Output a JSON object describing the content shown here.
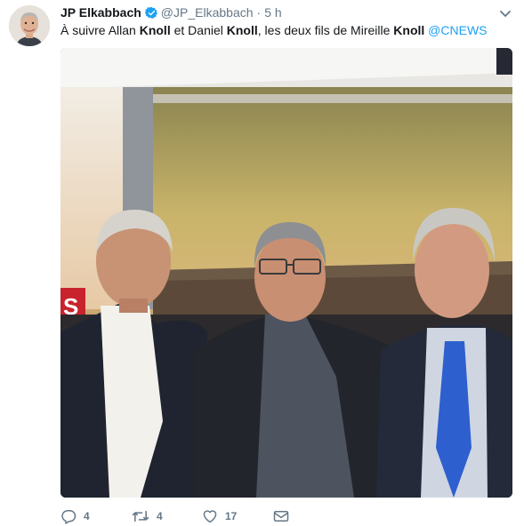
{
  "tweet": {
    "display_name": "JP Elkabbach",
    "verified_icon": "verified-badge-icon",
    "handle": "@JP_Elkabbach",
    "separator": "·",
    "time": "5 h",
    "text_parts": {
      "t1": "À suivre Allan ",
      "b1": "Knoll",
      "t2": " et Daniel ",
      "b2": "Knoll",
      "t3": ", les deux fils de Mireille ",
      "b3": "Knoll",
      "mention": "@CNEWS"
    },
    "actions": {
      "replies": "4",
      "retweets": "4",
      "likes": "17"
    },
    "colors": {
      "link": "#1da1f2",
      "meta": "#657786",
      "verified": "#1da1f2"
    }
  }
}
